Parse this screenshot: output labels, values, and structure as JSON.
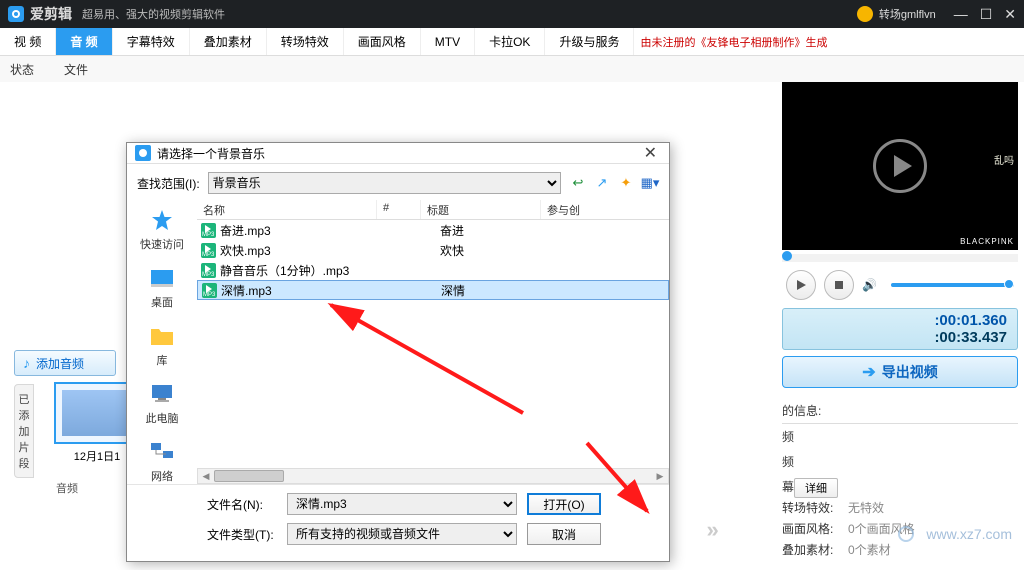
{
  "titlebar": {
    "app_name": "爱剪辑",
    "subtitle": "超易用、强大的视频剪辑软件",
    "username": "转场gmlflvn"
  },
  "tabs": {
    "items": [
      "视 频",
      "音 频",
      "字幕特效",
      "叠加素材",
      "转场特效",
      "画面风格",
      "MTV",
      "卡拉OK",
      "升级与服务"
    ],
    "active_index": 1,
    "right_note": "由未注册的《友锋电子相册制作》生成"
  },
  "status": {
    "col1": "状态",
    "col2": "文件"
  },
  "sidebar": {
    "add_audio": "添加音频",
    "segment_label": "已添加片段"
  },
  "thumb": {
    "label": "12月1日1"
  },
  "track_label": "音频",
  "preview": {
    "badge": "BLACKPINK",
    "cn": "乱吗"
  },
  "timecode": {
    "current": ":00:01.360",
    "total": ":00:33.437"
  },
  "export_label": "导出视频",
  "info": {
    "head": "的信息:",
    "detail_btn": "详细"
  },
  "fx": {
    "r1_label": "转场特效:",
    "r1_val": "无特效",
    "r2_label": "画面风格:",
    "r2_val": "0个画面风格",
    "r3_label": "叠加素材:",
    "r3_val": "0个素材"
  },
  "dialog": {
    "title": "请选择一个背景音乐",
    "search_label": "查找范围(I):",
    "search_value": "背景音乐",
    "places": {
      "quick": "快速访问",
      "desktop": "桌面",
      "library": "库",
      "pc": "此电脑",
      "network": "网络"
    },
    "cols": {
      "name": "名称",
      "size": "#",
      "title": "标题",
      "auth": "参与创"
    },
    "files": [
      {
        "name": "奋进.mp3",
        "title": "奋进"
      },
      {
        "name": "欢快.mp3",
        "title": "欢快"
      },
      {
        "name": "静音音乐（1分钟）.mp3",
        "title": ""
      },
      {
        "name": "深情.mp3",
        "title": "深情"
      }
    ],
    "fn_label": "文件名(N):",
    "fn_value": "深情.mp3",
    "ft_label": "文件类型(T):",
    "ft_value": "所有支持的视频或音频文件",
    "open_btn": "打开(O)",
    "cancel_btn": "取消"
  },
  "watermark": "www.xz7.com"
}
